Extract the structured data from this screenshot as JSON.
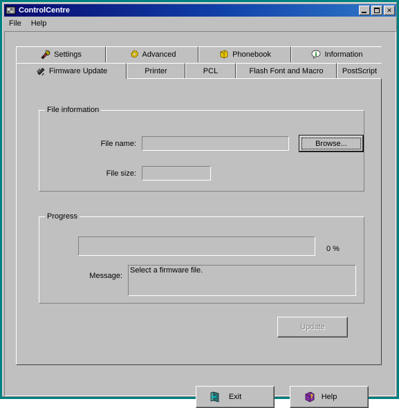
{
  "window": {
    "title": "ControlCentre",
    "title_icon": "application-icon",
    "controls": {
      "minimize": "minimize-button",
      "maximize": "maximize-button",
      "close_label": "✕"
    }
  },
  "menubar": {
    "items": [
      {
        "label": "File"
      },
      {
        "label": "Help"
      }
    ]
  },
  "tabs": {
    "row1": [
      {
        "label": "Settings",
        "icon": "tools-icon",
        "active": false
      },
      {
        "label": "Advanced",
        "icon": "gear-icon",
        "active": false
      },
      {
        "label": "Phonebook",
        "icon": "book-icon",
        "active": false
      },
      {
        "label": "Information",
        "icon": "info-bubble-icon",
        "active": false
      }
    ],
    "row2": [
      {
        "label": "Firmware Update",
        "icon": "chip-icon",
        "active": true
      },
      {
        "label": "Printer",
        "icon": "",
        "active": false
      },
      {
        "label": "PCL",
        "icon": "",
        "active": false
      },
      {
        "label": "Flash Font and Macro",
        "icon": "",
        "active": false
      },
      {
        "label": "PostScript",
        "icon": "",
        "active": false
      }
    ]
  },
  "file_information": {
    "group_title": "File information",
    "file_name_label": "File name:",
    "file_name_value": "",
    "file_size_label": "File size:",
    "file_size_value": "",
    "browse_label": "Browse..."
  },
  "progress": {
    "group_title": "Progress",
    "percent_value": 0,
    "percent_label": "0 %",
    "message_label": "Message:",
    "message_value": "Select a firmware file."
  },
  "actions": {
    "update_label": "Update",
    "update_enabled": false,
    "exit_label": "Exit",
    "exit_icon": "exit-door-icon",
    "help_label": "Help",
    "help_icon": "help-book-icon"
  },
  "colors": {
    "face": "#c0c0c0",
    "window_border": "#008080",
    "title_gradient_start": "#0a0a6e",
    "title_gradient_end": "#2f78c8",
    "disabled_text": "#808080",
    "progress_fill": "#000080"
  }
}
